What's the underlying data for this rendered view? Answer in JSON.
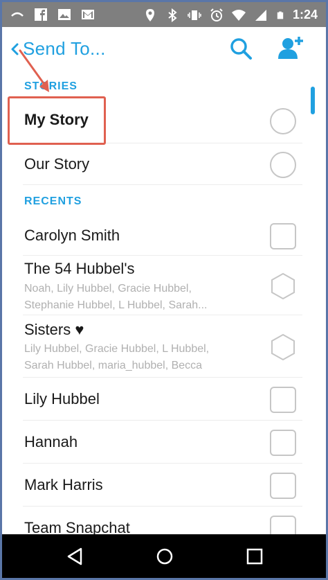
{
  "status_bar": {
    "time": "1:24",
    "left_icons": [
      "cast-icon",
      "facebook-icon",
      "image-icon",
      "gmail-icon"
    ],
    "right_icons": [
      "location-icon",
      "bluetooth-icon",
      "vibrate-icon",
      "alarm-icon",
      "wifi-icon",
      "signal-icon",
      "battery-icon"
    ]
  },
  "header": {
    "title": "Send To...",
    "back_icon": "chevron-left-icon",
    "search_icon": "search-icon",
    "add_friend_icon": "add-friend-icon"
  },
  "sections": {
    "stories": "STORIES",
    "recents": "RECENTS"
  },
  "stories": [
    {
      "name": "My Story",
      "selector": "circle",
      "highlighted": true
    },
    {
      "name": "Our Story",
      "selector": "circle"
    }
  ],
  "recents": [
    {
      "name": "Carolyn Smith",
      "selector": "square"
    },
    {
      "name": "The 54 Hubbel's",
      "members_line1": "Noah, Lily Hubbel, Gracie Hubbel,",
      "members_line2": "Stephanie Hubbel, L Hubbel, Sarah...",
      "selector": "hexagon"
    },
    {
      "name": "Sisters ♥",
      "members_line1": "Lily Hubbel, Gracie Hubbel, L Hubbel,",
      "members_line2": "Sarah Hubbel, maria_hubbel, Becca",
      "selector": "hexagon"
    },
    {
      "name": "Lily Hubbel",
      "selector": "square"
    },
    {
      "name": "Hannah",
      "selector": "square"
    },
    {
      "name": "Mark Harris",
      "selector": "square"
    },
    {
      "name": "Team Snapchat",
      "selector": "square"
    }
  ],
  "nav_bar": {
    "icons": [
      "back-triangle-icon",
      "home-circle-icon",
      "recents-square-icon"
    ]
  },
  "colors": {
    "accent": "#20a0e0",
    "highlight": "#e06050",
    "status_bar": "#7f7f7f",
    "frame": "#5a76a8"
  }
}
